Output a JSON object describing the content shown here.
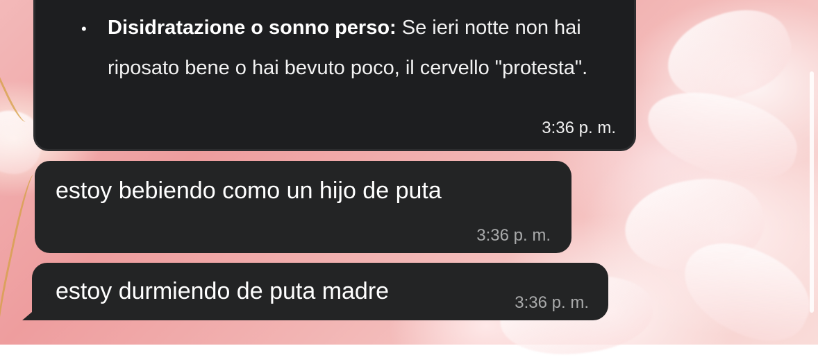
{
  "messages": [
    {
      "bullet_marker": "•",
      "bold_prefix": "Disidratazione o sonno perso:",
      "text": " Se ieri notte non hai riposato bene o hai bevuto poco, il cervello \"protesta\".",
      "time": "3:36 p. m."
    },
    {
      "text": "estoy bebiendo como un hijo de puta",
      "time": "3:36 p. m."
    },
    {
      "text": "estoy durmiendo de puta madre",
      "time": "3:36 p. m."
    }
  ],
  "colors": {
    "bubble": "#232425",
    "wallpaper_accent": "#ee9d9e",
    "timestamp": "#a9aaab"
  }
}
